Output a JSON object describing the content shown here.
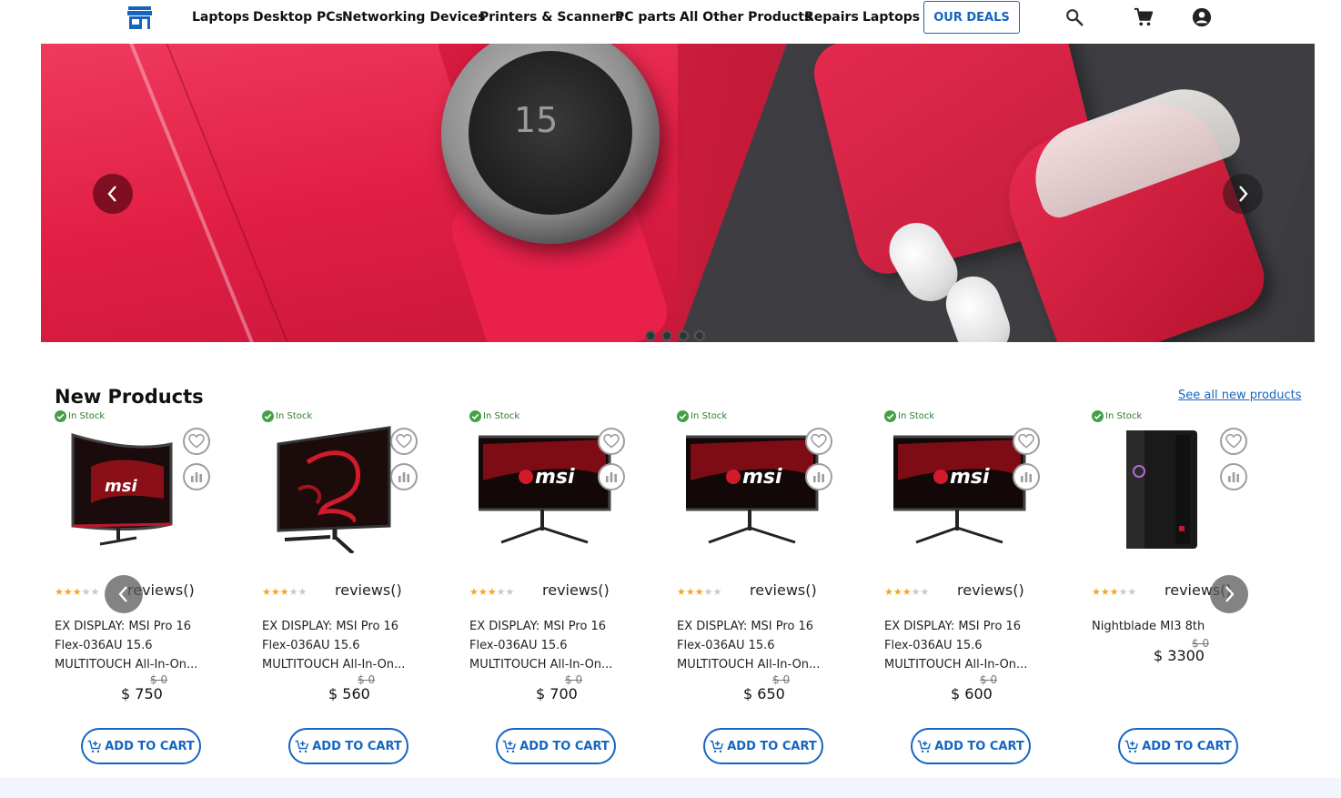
{
  "header": {
    "logo_icon": "storefront-icon",
    "nav": [
      "Laptops",
      "Desktop PCs",
      "Networking Devices",
      "Printers & Scanners",
      "PC parts",
      "All Other Products",
      "Repairs",
      "Laptops"
    ],
    "deals_label": "OUR DEALS",
    "icons": [
      "search-icon",
      "cart-icon",
      "account-icon"
    ]
  },
  "hero": {
    "watch_number": "15",
    "slides_count": 4
  },
  "new_products": {
    "title": "New Products",
    "see_all": "See all new products",
    "products": [
      {
        "stock": "In Stock",
        "rating": 3,
        "reviews": "reviews()",
        "name": "EX DISPLAY: MSI Pro 16 Flex-036AU 15.6 MULTITOUCH All-In-On...",
        "old_price": "$ 0",
        "price": "$ 750",
        "cart": "ADD TO CART"
      },
      {
        "stock": "In Stock",
        "rating": 3,
        "reviews": "reviews()",
        "name": "EX DISPLAY: MSI Pro 16 Flex-036AU 15.6 MULTITOUCH All-In-On...",
        "old_price": "$ 0",
        "price": "$ 560",
        "cart": "ADD TO CART"
      },
      {
        "stock": "In Stock",
        "rating": 3,
        "reviews": "reviews()",
        "name": "EX DISPLAY: MSI Pro 16 Flex-036AU 15.6 MULTITOUCH All-In-On...",
        "old_price": "$ 0",
        "price": "$ 700",
        "cart": "ADD TO CART"
      },
      {
        "stock": "In Stock",
        "rating": 3,
        "reviews": "reviews()",
        "name": "EX DISPLAY: MSI Pro 16 Flex-036AU 15.6 MULTITOUCH All-In-On...",
        "old_price": "$ 0",
        "price": "$ 650",
        "cart": "ADD TO CART"
      },
      {
        "stock": "In Stock",
        "rating": 3,
        "reviews": "reviews()",
        "name": "EX DISPLAY: MSI Pro 16 Flex-036AU 15.6 MULTITOUCH All-In-On...",
        "old_price": "$ 0",
        "price": "$ 600",
        "cart": "ADD TO CART"
      },
      {
        "stock": "In Stock",
        "rating": 3,
        "reviews": "reviews()",
        "name": "Nightblade MI3 8th",
        "old_price": "$ 0",
        "price": "$ 3300",
        "cart": "ADD TO CART"
      }
    ]
  },
  "colors": {
    "accent": "#1565c0",
    "star": "#f5a623",
    "in_stock": "#43a047"
  }
}
